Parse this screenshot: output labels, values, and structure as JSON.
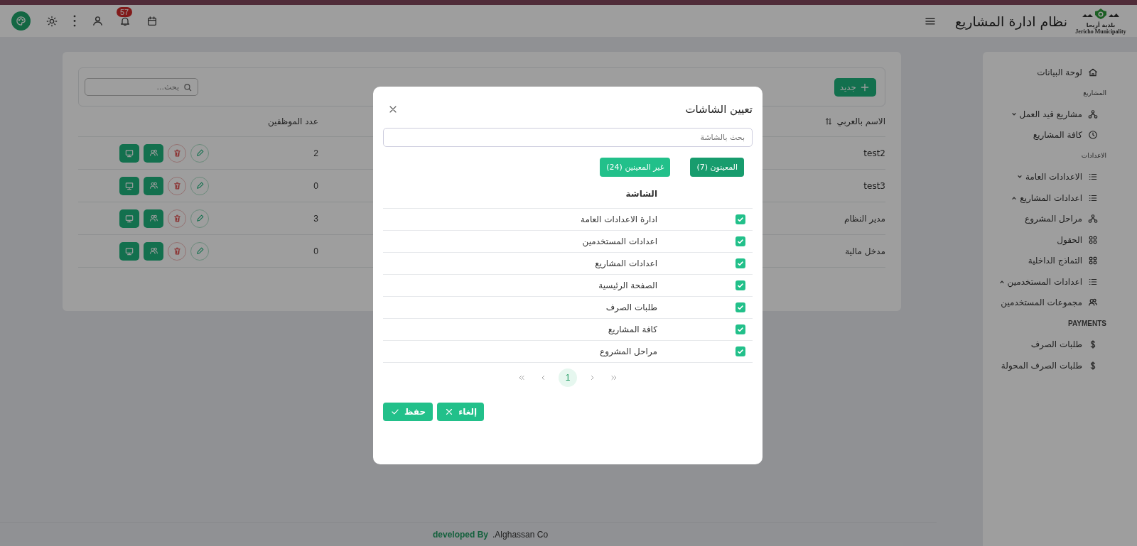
{
  "header": {
    "logo_lines": [
      "بلدية أريحا",
      "Jericho Municipality"
    ],
    "title": "نظام ادارة المشاريع",
    "notification_count": "57"
  },
  "sidebar": {
    "items": [
      {
        "kind": "link",
        "label": "لوحة البيانات"
      },
      {
        "kind": "section",
        "label": "المشاريع"
      },
      {
        "kind": "group",
        "label": "مشاريع قيد العمل",
        "expanded": false
      },
      {
        "kind": "link",
        "label": "كافة المشاريع"
      },
      {
        "kind": "section",
        "label": "الاعدادات"
      },
      {
        "kind": "group",
        "label": "الاعدادات العامة",
        "expanded": false
      },
      {
        "kind": "group",
        "label": "اعدادات المشاريع",
        "expanded": true
      },
      {
        "kind": "link",
        "label": "مراحل المشروع"
      },
      {
        "kind": "link",
        "label": "الحقول"
      },
      {
        "kind": "link",
        "label": "التماذج الداخلية"
      },
      {
        "kind": "group",
        "label": "اعدادات المستخدمين",
        "expanded": true
      },
      {
        "kind": "link",
        "label": "مجموعات المستخدمين"
      },
      {
        "kind": "section",
        "label": "PAYMENTS"
      },
      {
        "kind": "link",
        "label": "طلبات الصرف"
      },
      {
        "kind": "link",
        "label": "طلبات الصرف المحولة"
      }
    ]
  },
  "toolbar": {
    "new_button": "جديد",
    "search": {
      "placeholder": "بحث..."
    }
  },
  "table": {
    "columns": [
      "الاسم بالعربي",
      "عدد الموظفين"
    ],
    "rows": [
      {
        "name": "test2",
        "employees": "2"
      },
      {
        "name": "test3",
        "employees": "0"
      },
      {
        "name": "مدير النظام",
        "employees": "3"
      },
      {
        "name": "مدخل مالية",
        "employees": "0"
      }
    ]
  },
  "modal": {
    "title": "تعيين الشاشات",
    "search": {
      "placeholder": "بحث بالشاشة"
    },
    "tabs": [
      {
        "label": "المعينون (7)",
        "selected": true
      },
      {
        "label": "غير المعينين (24)",
        "selected": false
      }
    ],
    "column": "الشاشة",
    "rows": [
      {
        "label": "ادارة الاعدادات العامة",
        "checked": true
      },
      {
        "label": "اعدادات المستخدمين",
        "checked": true
      },
      {
        "label": "اعدادات المشاريع",
        "checked": true
      },
      {
        "label": "الصفحة الرئيسية",
        "checked": true
      },
      {
        "label": "طلبات الصرف",
        "checked": true
      },
      {
        "label": "كافة المشاريع",
        "checked": true
      },
      {
        "label": "مراحل المشروع",
        "checked": true
      }
    ],
    "pages": [
      {
        "label": "1",
        "selected": true
      }
    ],
    "buttons": [
      {
        "kind": "cancel",
        "label": "إلغاء"
      },
      {
        "kind": "save",
        "label": "حفظ"
      }
    ]
  },
  "footer": {
    "label": "developed By",
    "company": ".Alghassan Co"
  }
}
